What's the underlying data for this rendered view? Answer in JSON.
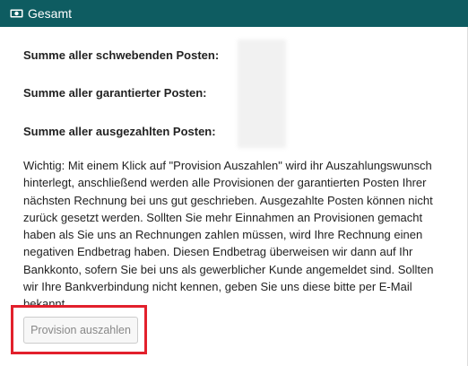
{
  "panel": {
    "title": "Gesamt",
    "icon": "money-bill-icon",
    "header_color": "#0e5c61"
  },
  "summary": {
    "pending_label": "Summe aller schwebenden Posten:",
    "guaranteed_label": "Summe aller garantierter Posten:",
    "paid_label": "Summe aller ausgezahlten Posten:"
  },
  "notice": {
    "text": "Wichtig: Mit einem Klick auf \"Provision Auszahlen\" wird ihr Auszahlungswunsch hinterlegt, anschließend werden alle Provisionen der garantierten Posten Ihrer nächsten Rechnung bei uns gut geschrieben. Ausgezahlte Posten können nicht zurück gesetzt werden. Sollten Sie mehr Einnahmen an Provisionen gemacht haben als Sie uns an Rechnungen zahlen müssen, wird Ihre Rechnung einen negativen Endbetrag haben. Diesen Endbetrag überweisen wir dann auf Ihr Bankkonto, sofern Sie bei uns als gewerblicher Kunde angemeldet sind. Sollten wir Ihre Bankverbindung nicht kennen, geben Sie uns diese bitte per E-Mail bekannt."
  },
  "actions": {
    "payout_button_label": "Provision auszahlen",
    "highlight_color": "#e2202c"
  }
}
